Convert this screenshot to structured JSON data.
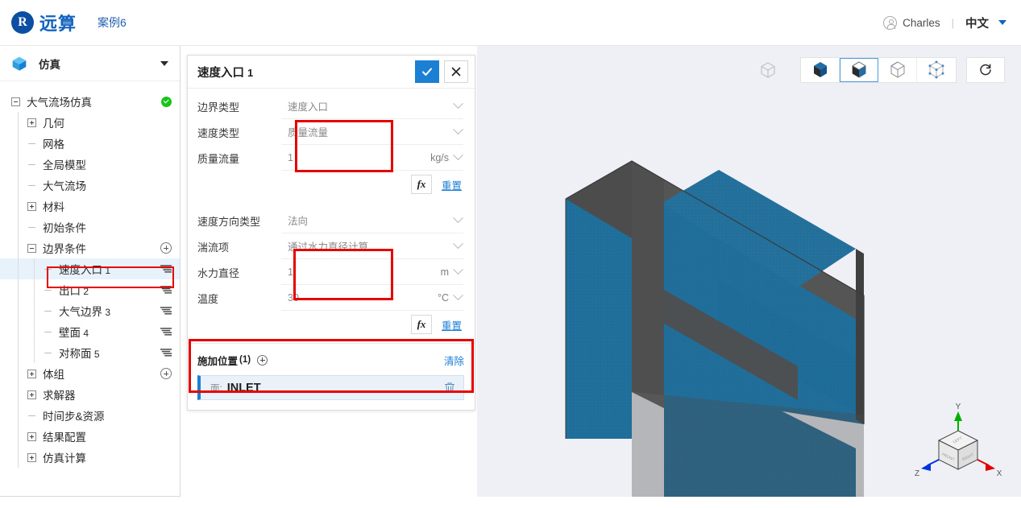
{
  "topbar": {
    "brand": "远算",
    "case_name": "案例6",
    "user_name": "Charles",
    "divider": "|",
    "language": "中文",
    "user_icon": "user-circle-icon",
    "caret_icon": "chevron-down-icon"
  },
  "sidebar": {
    "header": {
      "title": "仿真",
      "icon": "cube-icon",
      "caret": "chevron-down-icon"
    },
    "tree": [
      {
        "label": "大气流场仿真",
        "indent": 0,
        "toggle": "minus",
        "status": "ok",
        "selected": false
      },
      {
        "label": "几何",
        "indent": 1,
        "toggle": "plus",
        "selected": false
      },
      {
        "label": "网格",
        "indent": 1,
        "toggle": "dash",
        "selected": false
      },
      {
        "label": "全局模型",
        "indent": 1,
        "toggle": "dash",
        "selected": false
      },
      {
        "label": "大气流场",
        "indent": 1,
        "toggle": "dash",
        "selected": false
      },
      {
        "label": "材料",
        "indent": 1,
        "toggle": "plus",
        "selected": false
      },
      {
        "label": "初始条件",
        "indent": 1,
        "toggle": "dash",
        "selected": false
      },
      {
        "label": "边界条件",
        "indent": 1,
        "toggle": "minus",
        "action": "add",
        "selected": false
      },
      {
        "label": "速度入口",
        "num": "1",
        "indent": 2,
        "toggle": "dash",
        "action": "list",
        "selected": true
      },
      {
        "label": "出口",
        "num": "2",
        "indent": 2,
        "toggle": "dash",
        "action": "list",
        "selected": false
      },
      {
        "label": "大气边界",
        "num": "3",
        "indent": 2,
        "toggle": "dash",
        "action": "list",
        "selected": false
      },
      {
        "label": "壁面",
        "num": "4",
        "indent": 2,
        "toggle": "dash",
        "action": "list",
        "selected": false
      },
      {
        "label": "对称面",
        "num": "5",
        "indent": 2,
        "toggle": "dash",
        "action": "list",
        "selected": false
      },
      {
        "label": "体组",
        "indent": 1,
        "toggle": "plus",
        "action": "add",
        "selected": false
      },
      {
        "label": "求解器",
        "indent": 1,
        "toggle": "plus",
        "selected": false
      },
      {
        "label": "时间步&资源",
        "indent": 1,
        "toggle": "dash",
        "selected": false
      },
      {
        "label": "结果配置",
        "indent": 1,
        "toggle": "plus",
        "selected": false
      },
      {
        "label": "仿真计算",
        "indent": 1,
        "toggle": "plus",
        "selected": false
      }
    ]
  },
  "panel": {
    "title": "速度入口",
    "title_num": "1",
    "confirm_icon": "check-icon",
    "close_icon": "close-icon",
    "group1": [
      {
        "label": "边界类型",
        "value": "速度入口",
        "type": "select",
        "unit": "",
        "highlight": false
      },
      {
        "label": "速度类型",
        "value": "质量流量",
        "type": "select",
        "unit": "",
        "highlight": true
      },
      {
        "label": "质量流量",
        "value": "1",
        "type": "input",
        "unit": "kg/s",
        "highlight": true
      }
    ],
    "group1_actions": {
      "fx": "fx",
      "reset": "重置"
    },
    "group2": [
      {
        "label": "速度方向类型",
        "value": "法向",
        "type": "select",
        "unit": "",
        "highlight": false
      },
      {
        "label": "湍流项",
        "value": "通过水力直径计算",
        "type": "select",
        "unit": "",
        "highlight": false
      },
      {
        "label": "水力直径",
        "value": "1",
        "type": "input",
        "unit": "m",
        "highlight": true
      },
      {
        "label": "温度",
        "value": "30",
        "type": "input",
        "unit": "°C",
        "highlight": true
      }
    ],
    "group2_actions": {
      "fx": "fx",
      "reset": "重置"
    },
    "location": {
      "title": "施加位置",
      "count": "(1)",
      "add_icon": "plus-circle-icon",
      "clear_label": "清除",
      "items": [
        {
          "kind": "面:",
          "name": "INLET",
          "delete_icon": "trash-icon"
        }
      ]
    }
  },
  "viewport": {
    "toolbar": [
      {
        "name": "wireframe-box-icon",
        "active": false,
        "standalone": true
      },
      {
        "name": "solid-shaded-box-icon",
        "active": false
      },
      {
        "name": "shaded-edges-box-icon",
        "active": true
      },
      {
        "name": "outline-box-icon",
        "active": false
      },
      {
        "name": "points-box-icon",
        "active": false
      },
      {
        "name": "reset-view-icon",
        "active": false,
        "standalone": true
      }
    ],
    "axis_labels": {
      "x": "X",
      "y": "Y",
      "z": "Z"
    },
    "cube_faces": {
      "top": "LEFT",
      "front": "FRONT",
      "right": "RIGHT"
    },
    "colors": {
      "background": "#eef0f5",
      "mesh_face": "#1f6d99",
      "mesh_top": "#4a4a4a",
      "accent": "#1b7fd4",
      "highlight": "#e60000"
    }
  }
}
